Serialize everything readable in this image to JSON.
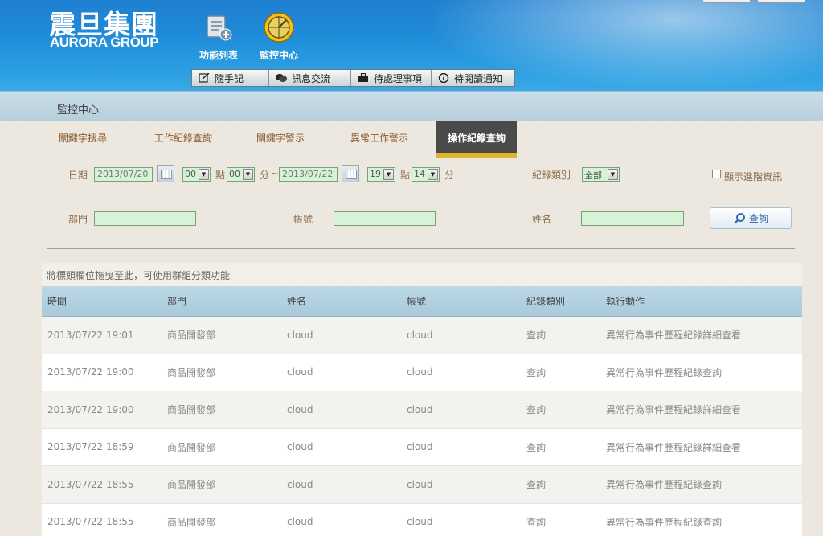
{
  "brand": {
    "name_cn": "震旦集團",
    "name_en": "AURORA GROUP"
  },
  "nav": {
    "function_list": "功能列表",
    "monitor_center": "監控中心"
  },
  "toolbar": {
    "memo": "隨手記",
    "messages": "訊息交流",
    "pending_tasks": "待處理事項",
    "unread_notices": "待閱讀通知"
  },
  "breadcrumb": "監控中心",
  "tabs": [
    {
      "label": "關鍵字搜尋"
    },
    {
      "label": "工作紀錄查詢"
    },
    {
      "label": "關鍵字警示"
    },
    {
      "label": "異常工作警示"
    },
    {
      "label": "操作紀錄查詢",
      "active": true
    }
  ],
  "filters": {
    "date_label": "日期",
    "start_date": "2013/07/20",
    "start_hour": "00",
    "hour_unit": "點",
    "start_min": "00",
    "min_unit": "分",
    "range_sep": "~",
    "end_date": "2013/07/22",
    "end_hour": "19",
    "end_min": "14",
    "record_type_label": "紀錄類別",
    "record_type_value": "全部",
    "advanced_label": "顯示進階資訊",
    "dept_label": "部門",
    "account_label": "帳號",
    "name_label": "姓名",
    "search_button": "查詢"
  },
  "grid": {
    "group_hint": "將標頭欄位拖曳至此，可使用群組分類功能",
    "columns": [
      "時間",
      "部門",
      "姓名",
      "帳號",
      "紀錄類別",
      "執行動作"
    ],
    "rows": [
      [
        "2013/07/22 19:01",
        "商品開發部",
        "cloud",
        "cloud",
        "查詢",
        "異常行為事件歷程紀錄詳細查看"
      ],
      [
        "2013/07/22 19:00",
        "商品開發部",
        "cloud",
        "cloud",
        "查詢",
        "異常行為事件歷程紀錄查詢"
      ],
      [
        "2013/07/22 19:00",
        "商品開發部",
        "cloud",
        "cloud",
        "查詢",
        "異常行為事件歷程紀錄詳細查看"
      ],
      [
        "2013/07/22 18:59",
        "商品開發部",
        "cloud",
        "cloud",
        "查詢",
        "異常行為事件歷程紀錄詳細查看"
      ],
      [
        "2013/07/22 18:55",
        "商品開發部",
        "cloud",
        "cloud",
        "查詢",
        "異常行為事件歷程紀錄查詢"
      ],
      [
        "2013/07/22 18:55",
        "商品開發部",
        "cloud",
        "cloud",
        "查詢",
        "異常行為事件歷程紀錄查詢"
      ]
    ]
  },
  "colors": {
    "header_blue": "#1f8ad8",
    "tab_active_bg": "#4a4a4a",
    "tab_active_accent": "#e0b52a",
    "input_green": "#d6f3d6"
  }
}
